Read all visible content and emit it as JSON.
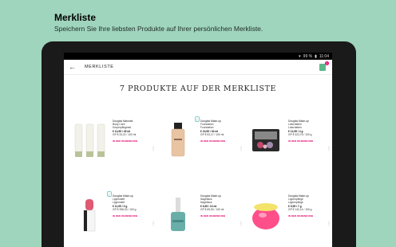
{
  "promo": {
    "title": "Merkliste",
    "subtitle": "Speichern Sie Ihre liebsten Produkte auf Ihrer persönlichen Merkliste."
  },
  "statusbar": {
    "battery": "99 %",
    "time": "11:04"
  },
  "appbar": {
    "title": "MERKLISTE",
    "bag_count": "2"
  },
  "list": {
    "heading": "7 PRODUKTE AUF DER MERKLISTE"
  },
  "products": [
    {
      "brand": "Douglas Naturals",
      "line": "Body Care",
      "name": "Körperpflegeset",
      "price": "€ 14,95 / 45 ml",
      "base": "GP € 33,22 / 100 ml",
      "stock": "IN DER WARENKORB"
    },
    {
      "brand": "Douglas Make-up",
      "line": "Foundation",
      "name": "Foundation",
      "price": "€ 15,95 / 30 ml",
      "base": "GP € 53,17 / 100 ml",
      "stock": "IN DER WARENKORB"
    },
    {
      "brand": "Douglas Make-up",
      "line": "Lidschatten",
      "name": "Lidschatten",
      "price": "€ 12,95 / 4 g",
      "base": "GP € 323,75 / 100 g",
      "stock": "IN DER WARENKORB"
    },
    {
      "brand": "Douglas Make-up",
      "line": "Lippenstift",
      "name": "Lippenstift",
      "price": "€ 11,95 / 3 g",
      "base": "GP € 398,33 / 100 g",
      "stock": "IN DER WARENKORB"
    },
    {
      "brand": "Douglas Make-up",
      "line": "Nagellack",
      "name": "Nagellack",
      "price": "€ 6,95 / 10 ml",
      "base": "GP € 69,50 / 100 ml",
      "stock": "IN DER WARENKORB"
    },
    {
      "brand": "Douglas Make-up",
      "line": "Lippenpflege",
      "name": "Lippenpflege",
      "price": "€ 9,95 / 7 g",
      "base": "GP € 142,14 / 100 g",
      "stock": "IN DER WARENKORB"
    }
  ],
  "colors": {
    "background": "#9fd4bd",
    "accent": "#e4006d",
    "brand_green": "#5cb88a"
  }
}
